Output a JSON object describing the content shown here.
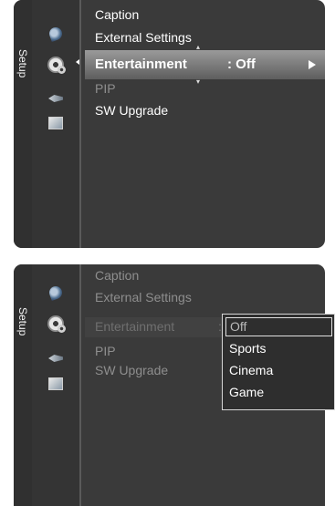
{
  "sidebar": {
    "tab_label": "Setup"
  },
  "menu": {
    "items": [
      "Caption",
      "External Settings",
      "Entertainment",
      "PIP",
      "SW Upgrade"
    ],
    "selected": {
      "label": "Entertainment",
      "value": ": Off"
    },
    "panel2_colon": ":"
  },
  "dropdown": {
    "options": [
      "Off",
      "Sports",
      "Cinema",
      "Game"
    ],
    "highlighted": "Off"
  },
  "icons": [
    "picture-icon",
    "setup-gear-icon",
    "input-icon",
    "application-icon",
    "chevron-right-icon",
    "chevron-left-icon",
    "scroll-up-icon",
    "scroll-down-icon"
  ],
  "colors": {
    "panel": "#3a3a3a",
    "highlight_bar": "#9a9a9a",
    "text": "#ffffff",
    "dim_text": "#8e8e8e"
  }
}
